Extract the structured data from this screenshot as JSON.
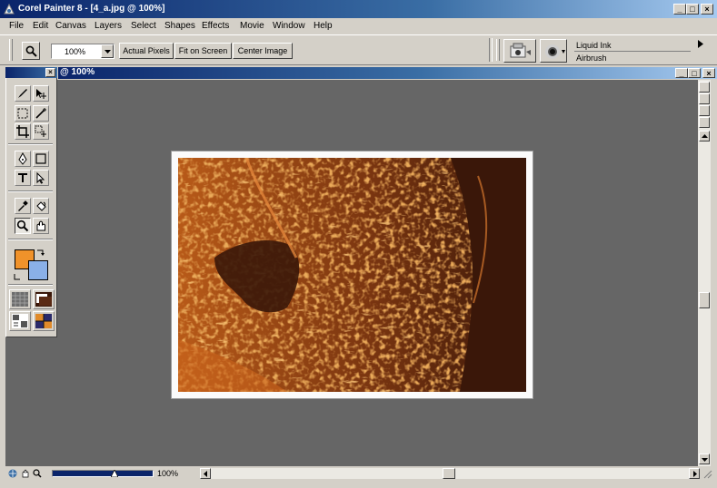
{
  "window": {
    "title": "Corel Painter 8 - [4_a.jpg @ 100%]",
    "controls": {
      "minimize": "_",
      "maximize": "□",
      "close": "×"
    }
  },
  "menu": {
    "items": [
      "File",
      "Edit",
      "Canvas",
      "Layers",
      "Select",
      "Shapes",
      "Effects",
      "Movie",
      "Window",
      "Help"
    ]
  },
  "property_bar": {
    "zoom_value": "100%",
    "buttons": [
      "Actual Pixels",
      "Fit on Screen",
      "Center Image"
    ],
    "brush_category": "Liquid Ink",
    "brush_variant": "Airbrush"
  },
  "document": {
    "title": "@ 100%"
  },
  "status": {
    "zoom": "100%"
  },
  "colors": {
    "title_bar": "#0a246a",
    "canvas_bg": "#666666",
    "main_color": "#f0922a",
    "additional_color": "#8ab0e8",
    "image_dark": "#3a1709",
    "image_orange": "#c9641c"
  },
  "tools": [
    "brush-icon",
    "selection-adjuster-icon",
    "rectangular-selection-icon",
    "magic-wand-icon",
    "crop-icon",
    "layer-adjuster-icon",
    "pen-icon",
    "rectangle-shape-icon",
    "text-icon",
    "shape-selection-icon",
    "dropper-icon",
    "paint-bucket-icon",
    "magnifier-icon",
    "grabber-icon"
  ]
}
